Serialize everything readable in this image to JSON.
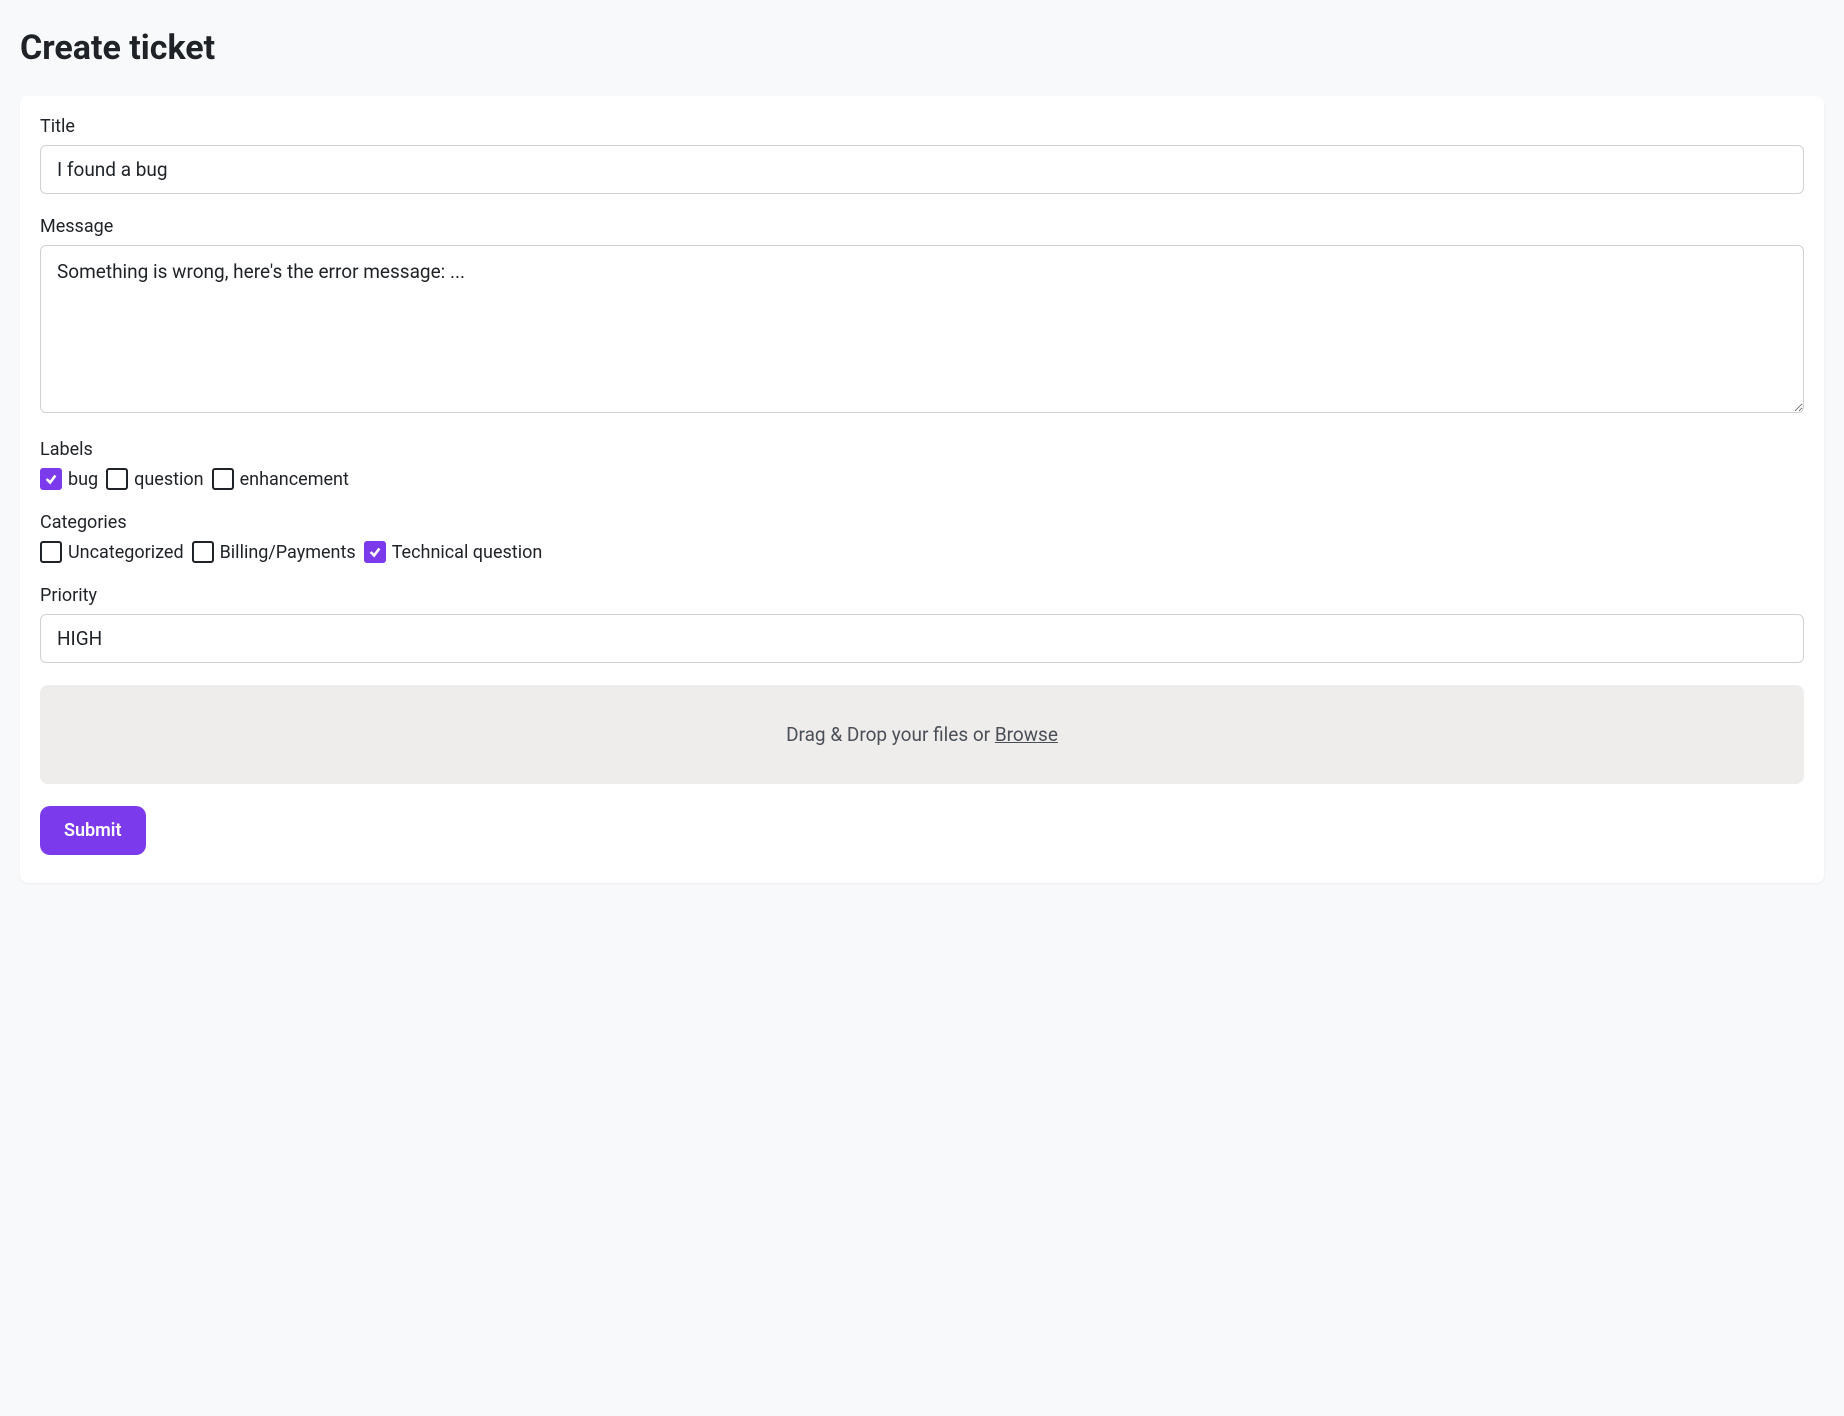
{
  "page": {
    "title": "Create ticket"
  },
  "form": {
    "title": {
      "label": "Title",
      "value": "I found a bug"
    },
    "message": {
      "label": "Message",
      "value": "Something is wrong, here's the error message: ..."
    },
    "labels": {
      "label": "Labels",
      "options": [
        {
          "label": "bug",
          "checked": true
        },
        {
          "label": "question",
          "checked": false
        },
        {
          "label": "enhancement",
          "checked": false
        }
      ]
    },
    "categories": {
      "label": "Categories",
      "options": [
        {
          "label": "Uncategorized",
          "checked": false
        },
        {
          "label": "Billing/Payments",
          "checked": false
        },
        {
          "label": "Technical question",
          "checked": true
        }
      ]
    },
    "priority": {
      "label": "Priority",
      "value": "HIGH"
    },
    "dropzone": {
      "text": "Drag & Drop your files or ",
      "browse": "Browse"
    },
    "submit": {
      "label": "Submit"
    }
  }
}
